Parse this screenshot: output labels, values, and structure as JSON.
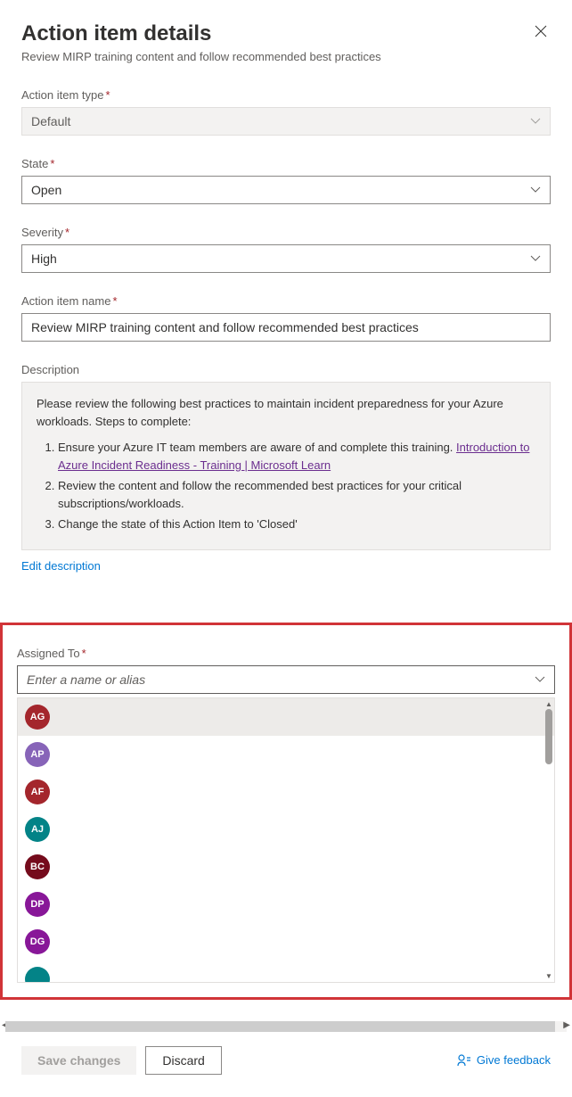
{
  "header": {
    "title": "Action item details",
    "subtitle": "Review MIRP training content and follow recommended best practices"
  },
  "fields": {
    "type": {
      "label": "Action item type",
      "value": "Default"
    },
    "state": {
      "label": "State",
      "value": "Open"
    },
    "severity": {
      "label": "Severity",
      "value": "High"
    },
    "name": {
      "label": "Action item name",
      "value": "Review MIRP training content and follow recommended best practices"
    },
    "description": {
      "label": "Description",
      "intro": "Please review the following best practices to maintain incident preparedness for your Azure workloads. Steps to complete:",
      "step1": "Ensure your Azure IT team members are aware of and complete this training. ",
      "step1_link": "Introduction to Azure Incident Readiness - Training | Microsoft Learn",
      "step2": "Review the content and follow the recommended best practices for your critical subscriptions/workloads.",
      "step3": "Change the state of this Action Item to 'Closed'"
    },
    "edit_description": "Edit description",
    "assigned_to": {
      "label": "Assigned To",
      "placeholder": "Enter a name or alias",
      "options": [
        {
          "initials": "AG",
          "color": "#a4262c"
        },
        {
          "initials": "AP",
          "color": "#8764b8"
        },
        {
          "initials": "AF",
          "color": "#a4262c"
        },
        {
          "initials": "AJ",
          "color": "#038387"
        },
        {
          "initials": "BC",
          "color": "#750b1c"
        },
        {
          "initials": "DP",
          "color": "#881798"
        },
        {
          "initials": "DG",
          "color": "#881798"
        },
        {
          "initials": "",
          "color": "#038387"
        }
      ]
    }
  },
  "footer": {
    "save": "Save changes",
    "discard": "Discard",
    "feedback": "Give feedback"
  }
}
